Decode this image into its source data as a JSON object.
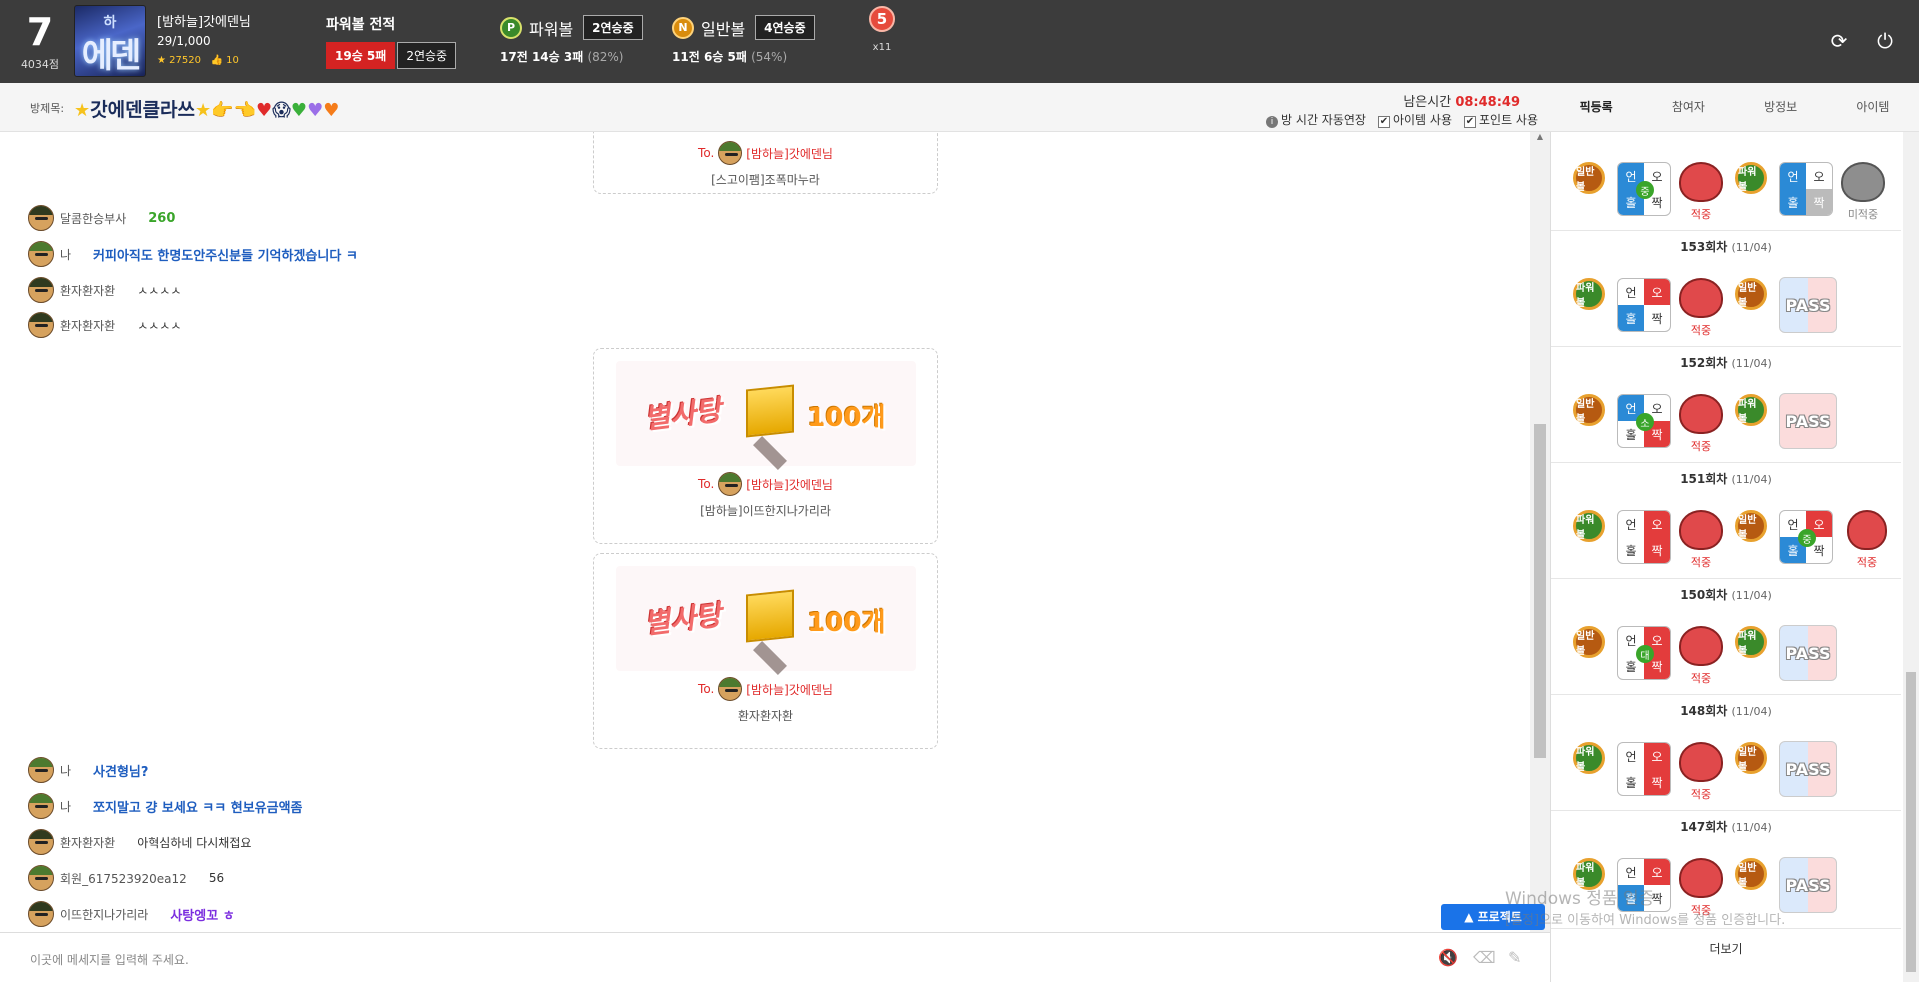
{
  "header": {
    "level": "7",
    "points": "4034점",
    "avatar_text_top": "하",
    "avatar_text": "에덴",
    "username": "[밤하늘]갓에덴님",
    "rank": "29/1,000",
    "stars": "27520",
    "likes": "10",
    "record_title": "파워볼 전적",
    "record_wl": "19승 5패",
    "record_streak": "2연승중",
    "powerball": {
      "ball": "P",
      "label": "파워볼",
      "streak": "2연승중",
      "games": "17전",
      "wins": "14승",
      "losses": "3패",
      "pct": "(82%)"
    },
    "normalball": {
      "ball": "N",
      "label": "일반볼",
      "streak": "4연승중",
      "games": "11전",
      "wins": "6승",
      "losses": "5패",
      "pct": "(54%)"
    },
    "medal_num": "5",
    "medal_count": "x11",
    "refresh_icon": "refresh-icon",
    "power_icon": "power-icon"
  },
  "room": {
    "label": "방제목:",
    "title": "갓에덴클라쓰",
    "time_label": "남은시간",
    "time": "08:48:49",
    "auto_extend": "방 시간 자동연장",
    "item_use": "아이템 사용",
    "point_use": "포인트 사용"
  },
  "tabs": [
    "픽등록",
    "참여자",
    "방정보",
    "아이템"
  ],
  "chat": {
    "top_gift": {
      "to_prefix": "To.",
      "to": "[밤하늘]갓에덴님",
      "from": "[스고이팸]조폭마누라"
    },
    "messages_a": [
      {
        "who": "달콤한승부사",
        "text": "260"
      },
      {
        "who": "나",
        "text": "커피아직도 한명도안주신분들 기억하겠습니다 ㅋ"
      },
      {
        "who": "환자환자환",
        "text": "ㅅㅅㅅㅅ"
      },
      {
        "who": "환자환자환",
        "text": "ㅅㅅㅅㅅ"
      }
    ],
    "gift1": {
      "banner": "별사탕",
      "count": "100개",
      "to_prefix": "To.",
      "to": "[밤하늘]갓에덴님",
      "from": "[밤하늘]이뜨한지나가리라"
    },
    "gift2": {
      "banner": "별사탕",
      "count": "100개",
      "to_prefix": "To.",
      "to": "[밤하늘]갓에덴님",
      "from": "환자환자환"
    },
    "messages_b": [
      {
        "who": "나",
        "text": "사견형님?"
      },
      {
        "who": "나",
        "text": "쪼지말고 걍 보세요 ㅋㅋ 현보유금액좀"
      },
      {
        "who": "환자환자환",
        "text": "아혁심하네 다시채접요"
      },
      {
        "who": "회원_617523920ea12",
        "text": "56"
      },
      {
        "who": "이뜨한지나가리라",
        "text": "사탕엥꼬 ㅎ"
      }
    ],
    "input_placeholder": "이곳에 메세지를 입력해 주세요.",
    "project_button": "▲ 프로젝트"
  },
  "side": {
    "rounds": [
      {
        "title": "",
        "date": ""
      },
      {
        "title": "153회차",
        "date": "(11/04)"
      },
      {
        "title": "152회차",
        "date": "(11/04)"
      },
      {
        "title": "151회차",
        "date": "(11/04)"
      },
      {
        "title": "150회차",
        "date": "(11/04)"
      },
      {
        "title": "148회차",
        "date": "(11/04)"
      },
      {
        "title": "147회차",
        "date": "(11/04)"
      }
    ],
    "pick_labels": [
      "일반볼",
      "파워볼",
      "파워볼",
      "일반볼",
      "일반볼",
      "파워볼",
      "파워볼",
      "일반볼",
      "일반볼",
      "파워볼",
      "파워볼",
      "일반볼",
      "파워볼",
      "일반볼"
    ],
    "hit": "적중",
    "miss": "미적중",
    "pass": "PASS",
    "g_odd": "오",
    "g_un": "언",
    "g_hol": "홀",
    "g_jjak": "짝",
    "marks": [
      "중",
      "소",
      "중",
      "대"
    ],
    "more": "더보기"
  },
  "watermark": {
    "line1": "Windows 정품 인증",
    "line2": "[설정]으로 이동하여 Windows를 정품 인증합니다."
  }
}
